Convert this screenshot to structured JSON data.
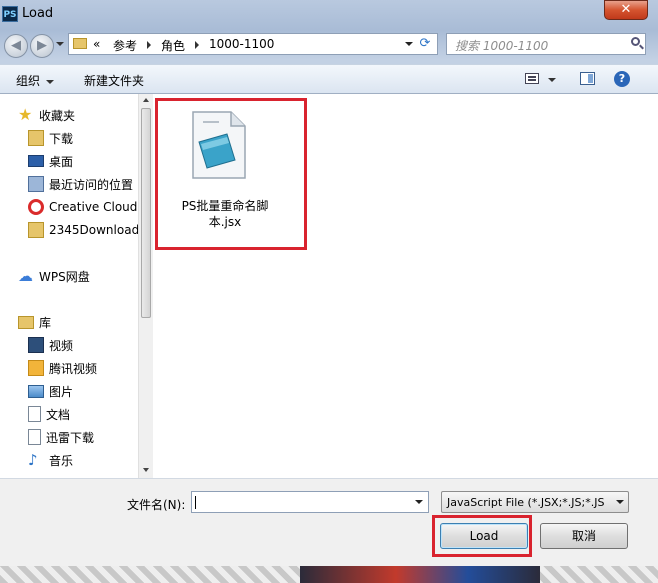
{
  "window": {
    "app_icon": "PS",
    "title": "Load",
    "close_glyph": "✕"
  },
  "address_bar": {
    "overflow": "«",
    "segments": [
      "参考",
      "角色",
      "1000-1100"
    ],
    "refresh_icon": "refresh-icon"
  },
  "search": {
    "placeholder": "搜索 1000-1100"
  },
  "toolbar": {
    "organize": "组织",
    "new_folder": "新建文件夹",
    "help": "?"
  },
  "navigation": {
    "favorites_header": "收藏夹",
    "favorites": [
      "下载",
      "桌面",
      "最近访问的位置",
      "Creative Cloud",
      "2345Download"
    ],
    "wps": "WPS网盘",
    "library_header": "库",
    "libraries": [
      "视频",
      "腾讯视频",
      "图片",
      "文档",
      "迅雷下载",
      "音乐"
    ]
  },
  "files": [
    {
      "name": "PS批量重命名脚本.jsx",
      "icon": "jsx-file-icon"
    }
  ],
  "bottom": {
    "filename_label": "文件名(N):",
    "filename_value": "",
    "filter_value": "JavaScript File (*.JSX;*.JS;*.JS",
    "load_label": "Load",
    "cancel_label": "取消"
  },
  "colors": {
    "highlight": "#d9232e",
    "close_button": "#d5542f"
  }
}
